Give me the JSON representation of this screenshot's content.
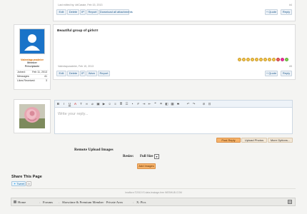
{
  "post1": {
    "byline": "Last edited by: ##Cassie, Feb 15, 2013",
    "number": "#4",
    "actions": [
      "Edit",
      "Delete",
      "IP",
      "Report",
      "Download all attachments"
    ],
    "quote": "+ Quote",
    "reply": "Reply"
  },
  "post2": {
    "username": "Valentapuradeier",
    "rank1": "Member",
    "rank2": "Principiante",
    "stats": [
      {
        "label": "Joined:",
        "value": "Feb 11, 2013"
      },
      {
        "label": "Messages:",
        "value": "41"
      },
      {
        "label": "Likes Received:",
        "value": "3"
      }
    ],
    "message": "Beautiful group of girls!!!",
    "byline": "Valentapuradeier, Feb 15, 2013",
    "number": "#5",
    "actions": [
      "Edit",
      "Delete",
      "IP",
      "Warn",
      "Report"
    ],
    "quote": "+ Quote",
    "reply": "Reply"
  },
  "editor": {
    "placeholder": "Write your reply...",
    "post_reply": "Post Reply",
    "upload_photos": "Upload Photos",
    "more_options": "More Options..."
  },
  "upload": {
    "title": "Remote Upload Images",
    "resize_label": "Resize:",
    "resize_value": "Full Size",
    "add_button": "Add Images"
  },
  "share": {
    "title": "Share This Page",
    "tweet_label": "Tweet",
    "tweet_count": "0"
  },
  "footer": {
    "credit": "Imaflora ©2013 IS data-leakage-free WEBHUB.COM",
    "breadcrumbs": [
      "Home",
      "Forums",
      "Showtime & Premium Member · Private Area",
      "X: Pics"
    ]
  },
  "colors": {
    "accent": "#1f5b8e",
    "avatar_bg": "#1a73c8",
    "post_reply_bg": "#f7b36a"
  }
}
